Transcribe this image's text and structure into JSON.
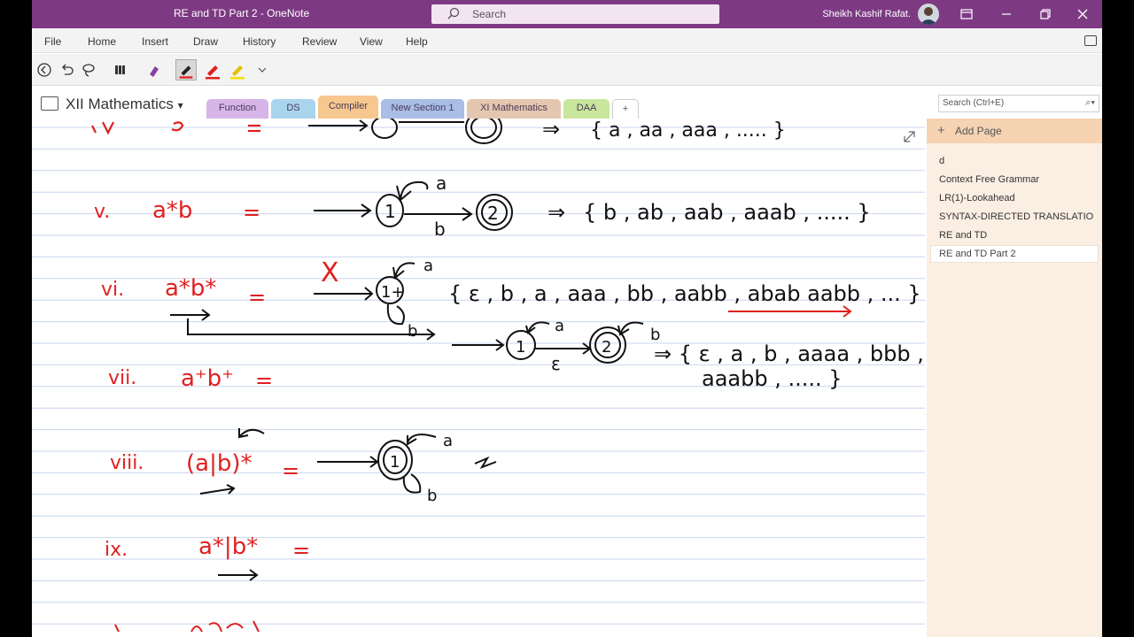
{
  "window": {
    "title": "RE and TD Part 2  -  OneNote",
    "search_label": "Search",
    "user": "Sheikh Kashif Rafat."
  },
  "menu": [
    "File",
    "Home",
    "Insert",
    "Draw",
    "History",
    "Review",
    "View",
    "Help"
  ],
  "notebook": {
    "name": "XII Mathematics"
  },
  "sections": [
    {
      "label": "Function",
      "color": "#d7b5e8"
    },
    {
      "label": "DS",
      "color": "#a9d4ee"
    },
    {
      "label": "Compiler",
      "color": "#f6c78e"
    },
    {
      "label": "New Section 1",
      "color": "#a9bde6"
    },
    {
      "label": "XI Mathematics",
      "color": "#e4c7b0"
    },
    {
      "label": "DAA",
      "color": "#c8e69c"
    },
    {
      "label": "+",
      "color": "#ffffff"
    }
  ],
  "search_placeholder": "Search (Ctrl+E)",
  "pages": {
    "add_label": "Add Page",
    "items": [
      "d",
      "Context Free Grammar",
      "LR(1)-Lookahead",
      "SYNTAX-DIRECTED TRANSLATIO",
      "RE and TD",
      "RE and TD Part 2"
    ],
    "selected": "RE and TD Part 2"
  },
  "ink": {
    "v_label": "v.",
    "v_expr": "a*b",
    "v_set": "{ b , ab , aab , aaab , ..... }",
    "vi_label": "vi.",
    "vi_expr": "a*b*",
    "vi_set": "{ ε , b , a , aaa , bb , aabb , abab aabb , ... }",
    "vi_nfa_set_1": "⇒ { ε , a , b , aaaa , bbb ,",
    "vi_nfa_set_2": "aaabb , ..... }",
    "vii_label": "vii.",
    "vii_expr": "a⁺b⁺",
    "viii_label": "viii.",
    "viii_expr": "(a|b)*",
    "ix_label": "ix.",
    "ix_expr": "a*|b*",
    "iv_set": "{ a , aa , aaa , ..... }",
    "eq": "=",
    "a": "a",
    "b": "b",
    "eps": "ε",
    "x": "X",
    "one": "1",
    "two": "2",
    "one_plus": "1+"
  },
  "colors": {
    "titlebar": "#7d3a83",
    "ink_red": "#e02020",
    "ink_black": "#111111",
    "rule": "#c8d6ee"
  }
}
